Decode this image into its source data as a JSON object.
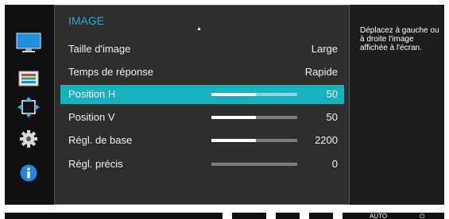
{
  "menu": {
    "title": "IMAGE",
    "items": [
      {
        "label": "Taille d'image",
        "value": "Large",
        "selected": false,
        "has_slider": false
      },
      {
        "label": "Temps de réponse",
        "value": "Rapide",
        "selected": false,
        "has_slider": false
      },
      {
        "label": "Position H",
        "value": "50",
        "selected": true,
        "has_slider": true,
        "slider_level": 0.52
      },
      {
        "label": "Position V",
        "value": "50",
        "selected": false,
        "has_slider": true,
        "slider_level": 0.52
      },
      {
        "label": "Régl. de base",
        "value": "2200",
        "selected": false,
        "has_slider": true,
        "slider_level": 0.52
      },
      {
        "label": "Régl. précis",
        "value": "0",
        "selected": false,
        "has_slider": true,
        "slider_level": 0.0
      }
    ]
  },
  "help_text": "Déplacez à gauche ou à droite l'image affichée à l'écran.",
  "sidebar_icons": [
    "monitor-icon",
    "color-bars-icon",
    "resize-arrows-icon",
    "gear-icon",
    "info-icon"
  ],
  "bottom_buttons": {
    "auto_label": "AUTO",
    "power_glyph": "⏻"
  },
  "colors": {
    "accent": "#16b2c0",
    "title": "#13b5d6",
    "menu_bg": "#2e2e2e",
    "osd_bg": "#111111"
  }
}
